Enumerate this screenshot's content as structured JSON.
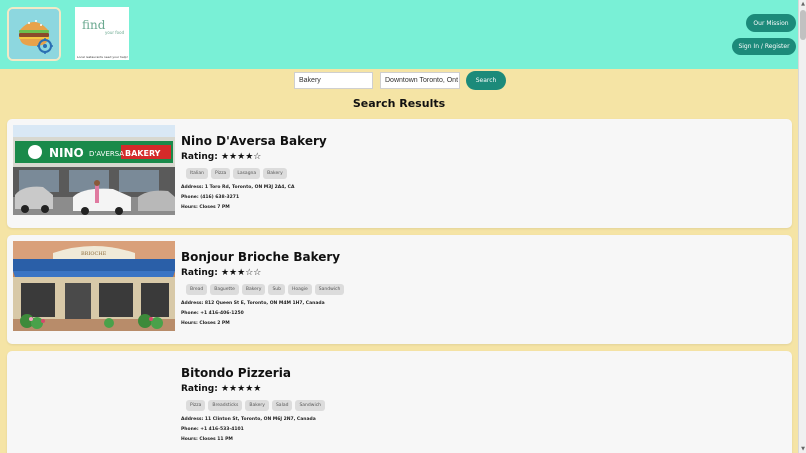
{
  "header": {
    "logo_find": "find",
    "logo_food": "your food",
    "logo_tagline": "Local restaurants need your help!",
    "mission_label": "Our Mission",
    "signin_label": "Sign In / Register"
  },
  "search": {
    "category_value": "Bakery",
    "location_value": "Downtown Toronto, Ont",
    "button_label": "Search"
  },
  "results_title": "Search Results",
  "restaurants": [
    {
      "name": "Nino D'Aversa Bakery",
      "rating_label": "Rating:",
      "stars": "★★★★☆",
      "rating_value": 4,
      "tags": [
        "Italian",
        "Pizza",
        "Lasagna",
        "Bakery"
      ],
      "address": "Address: 1 Toro Rd, Toronto, ON M3J 2A4, CA",
      "phone": "Phone: (416) 638-3271",
      "hours": "Hours: Closes 7 PM",
      "sign_text_1": "NINO",
      "sign_text_2": "D'AVERSA",
      "sign_text_3": "BAKERY"
    },
    {
      "name": "Bonjour Brioche Bakery",
      "rating_label": "Rating:",
      "stars": "★★★☆☆",
      "rating_value": 3,
      "tags": [
        "Bread",
        "Baguette",
        "Bakery",
        "Sub",
        "Hoagie",
        "Sandwich"
      ],
      "address": "Address: 812 Queen St E, Toronto, ON M4M 1H7, Canada",
      "phone": "Phone: +1 416-406-1250",
      "hours": "Hours: Closes 2 PM",
      "sign_text_1": "BRIOCHE"
    },
    {
      "name": "Bitondo Pizzeria",
      "rating_label": "Rating:",
      "stars": "★★★★★",
      "rating_value": 5,
      "tags": [
        "Pizza",
        "Breadsticks",
        "Bakery",
        "Salad",
        "Sandwich"
      ],
      "address": "Address: 11 Clinton St, Toronto, ON M6J 2N7, Canada",
      "phone": "Phone: +1 416-533-4101",
      "hours": "Hours: Closes 11 PM"
    }
  ]
}
